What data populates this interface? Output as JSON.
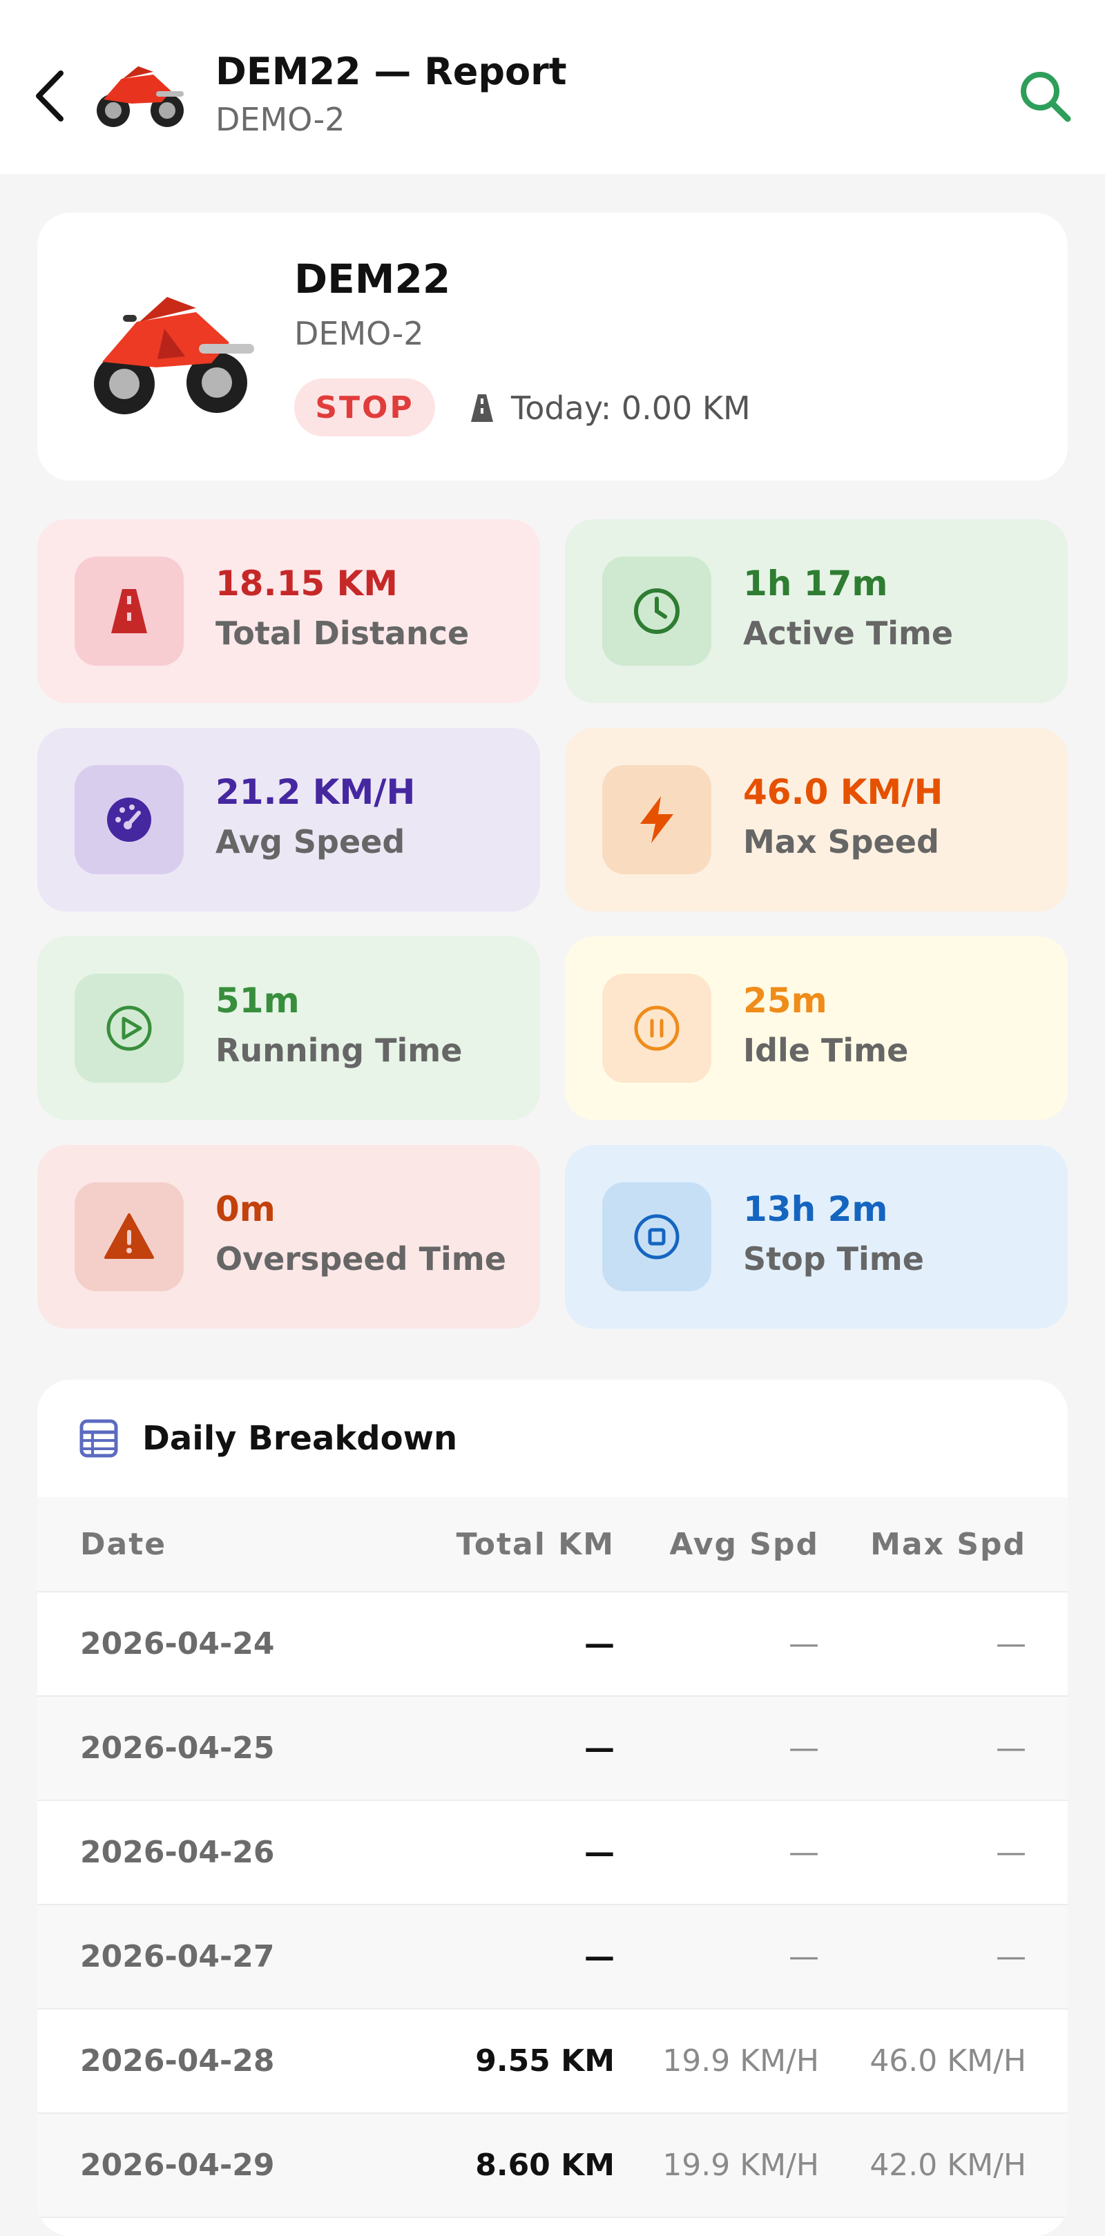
{
  "header": {
    "title": "DEM22 — Report",
    "subtitle": "DEMO-2",
    "back_icon": "chevron-left-icon",
    "search_icon": "search-icon"
  },
  "vehicle": {
    "name": "DEM22",
    "sub": "DEMO-2",
    "status": "STOP",
    "today": "Today: 0.00 KM"
  },
  "stats": [
    {
      "value": "18.15 KM",
      "label": "Total Distance",
      "icon": "road-icon",
      "color": "#c62828",
      "bg": "#fde8ea",
      "ibg": "#f7cdd2"
    },
    {
      "value": "1h 17m",
      "label": "Active Time",
      "icon": "clock-icon",
      "color": "#2e7d32",
      "bg": "#e6f3e6",
      "ibg": "#cfe8d0"
    },
    {
      "value": "21.2 KM/H",
      "label": "Avg Speed",
      "icon": "speedometer-icon",
      "color": "#4527a0",
      "bg": "#ece7f5",
      "ibg": "#d9cdee"
    },
    {
      "value": "46.0 KM/H",
      "label": "Max Speed",
      "icon": "bolt-icon",
      "color": "#e65100",
      "bg": "#fdf0e0",
      "ibg": "#f9dcc0"
    },
    {
      "value": "51m",
      "label": "Running Time",
      "icon": "play-circle-icon",
      "color": "#388e3c",
      "bg": "#e7f4e7",
      "ibg": "#d2ead3"
    },
    {
      "value": "25m",
      "label": "Idle Time",
      "icon": "pause-circle-icon",
      "color": "#ef8c1a",
      "bg": "#fffbe6",
      "ibg": "#fde6cc"
    },
    {
      "value": "0m",
      "label": "Overspeed Time",
      "icon": "warning-icon",
      "color": "#c2410c",
      "bg": "#fbe8e6",
      "ibg": "#f4cfca"
    },
    {
      "value": "13h 2m",
      "label": "Stop Time",
      "icon": "stop-circle-icon",
      "color": "#1565c0",
      "bg": "#e3f0fb",
      "ibg": "#c7dff5"
    }
  ],
  "breakdown": {
    "title": "Daily Breakdown",
    "icon": "table-icon",
    "columns": [
      "Date",
      "Total KM",
      "Avg Spd",
      "Max Spd"
    ],
    "rows": [
      {
        "date": "2026-04-24",
        "km": "—",
        "avg": "—",
        "max": "—"
      },
      {
        "date": "2026-04-25",
        "km": "—",
        "avg": "—",
        "max": "—"
      },
      {
        "date": "2026-04-26",
        "km": "—",
        "avg": "—",
        "max": "—"
      },
      {
        "date": "2026-04-27",
        "km": "—",
        "avg": "—",
        "max": "—"
      },
      {
        "date": "2026-04-28",
        "km": "9.55 KM",
        "avg": "19.9 KM/H",
        "max": "46.0 KM/H"
      },
      {
        "date": "2026-04-29",
        "km": "8.60 KM",
        "avg": "19.9 KM/H",
        "max": "42.0 KM/H"
      }
    ]
  }
}
